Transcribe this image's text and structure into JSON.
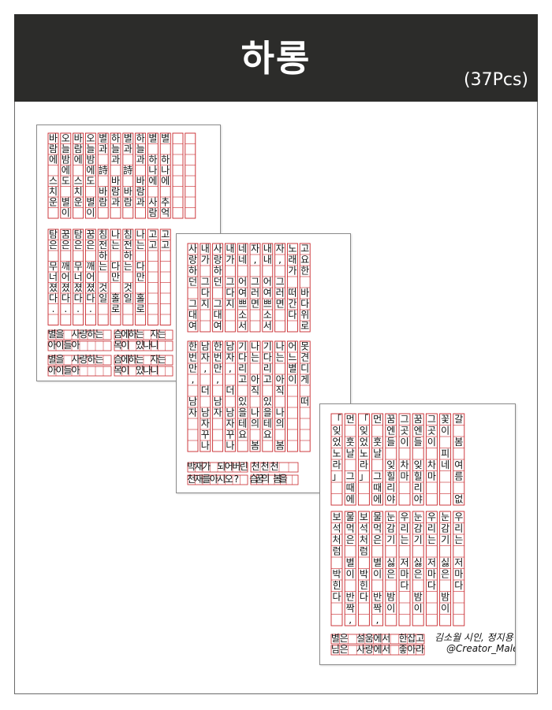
{
  "header": {
    "title": "하롱",
    "count": "(37Pcs)"
  },
  "colors": {
    "header_bg": "#2c2c2a",
    "grid_red": "#c8262b",
    "text": "#111111"
  },
  "sheet1": {
    "top_columns": [
      "바람에 스치운 다",
      "오늘밤에도 별이",
      "바람에 스치운 다",
      "오늘밤에도 별이",
      "별과 詩 바람",
      "하늘과 바람과",
      "별과 詩 바람",
      "하늘과 바람과",
      "별 하나에 사람",
      "별 하나에 추억과",
      "",
      ""
    ],
    "bottom_columns": [
      "탐은 무너졌다.",
      "꿈은 깨어졌다.",
      "탐은 무너졌다.",
      "꿈은 깨어졌다.",
      "침전하는 것일",
      "나는 다만 홀로",
      "침전하는 것일",
      "나는 다만 홀로",
      "고고",
      "고고"
    ],
    "strips": [
      "별을 사랑하는",
      "슴에하는 자는",
      "아이들아",
      "목이 있나니",
      "별을 사랑하는",
      "슴에하는 자는",
      "아이들아",
      "목이 있나니"
    ]
  },
  "sheet2": {
    "top_columns": [
      "사랑하던 그대여",
      "내가 그다지",
      "사랑하던 그대여",
      "내가 그다지",
      "네네 어여쁘소서",
      "자, 그러면",
      "내내 어여쁘소서",
      "자, 그러면",
      "노래가 떠간다",
      "고요한 바다위로"
    ],
    "bottom_columns": [
      "한번만, 남자",
      "남자, 더 남자꾸나",
      "한번만, 남자",
      "남자, 더 남자꾸나",
      "기다리고 있을테요",
      "나는 아직 나의 봄을",
      "기다리고 있을테요",
      "나는 아직 나의 봄을",
      "어느별이",
      "못견디게 떠"
    ],
    "strips": [
      "박재가 되어버린",
      "천천천",
      "천재를아시오?",
      "슴꿈의 봄을"
    ]
  },
  "sheet3": {
    "top_columns": [
      "「잊었노라」",
      "먼 훗날 그때에",
      "「잊었노라」",
      "먼 훗날 그때에",
      "꿈엔들 잊힐리야",
      "그곳이 차마",
      "꿈엔들 잊힐리야",
      "그곳이 차마",
      "꽃이 피네",
      "갈 봄 여름 없이"
    ],
    "bottom_columns": [
      "보석처럼 박힌다",
      "물먹은 별이 반짝,",
      "보석처럼 박힌다",
      "물먹은 별이 반짝,",
      "눈감기 싫은 밤이 있다",
      "우리는 저마다",
      "눈감기 싫은 밤이 있다",
      "우리는 저마다",
      "눈감기 싫은 밤이 있다",
      "우리는 저마다"
    ],
    "strips": [
      "별은 설움에서 한잡고",
      "님은 사랑에서 좋아라"
    ],
    "signature": "김소월 시인, 정지용 시인",
    "credit": "@Creator_Maleny"
  }
}
